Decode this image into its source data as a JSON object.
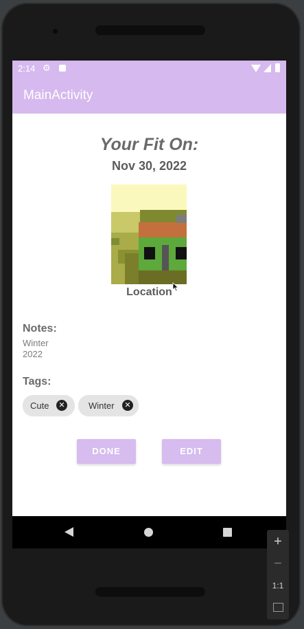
{
  "status_bar": {
    "time": "2:14",
    "icons": [
      "gear-icon",
      "notification-icon",
      "wifi-icon",
      "cell-signal-icon",
      "battery-icon"
    ]
  },
  "app_bar": {
    "title": "MainActivity",
    "color": "#d6b9ee"
  },
  "content": {
    "heading": "Your Fit On:",
    "date": "Nov 30, 2022",
    "image_label": "Location",
    "notes_label": "Notes:",
    "notes_text": "Winter 2022",
    "tags_label": "Tags:",
    "tags": [
      {
        "label": "Cute"
      },
      {
        "label": "Winter"
      }
    ],
    "done_label": "DONE",
    "edit_label": "EDIT",
    "button_color": "#d7bcef"
  },
  "nav_bar": {
    "icons": [
      "back-icon",
      "home-icon",
      "recents-icon"
    ]
  },
  "emulator_zoom": {
    "plus": "+",
    "minus": "−",
    "ratio": "1:1"
  }
}
